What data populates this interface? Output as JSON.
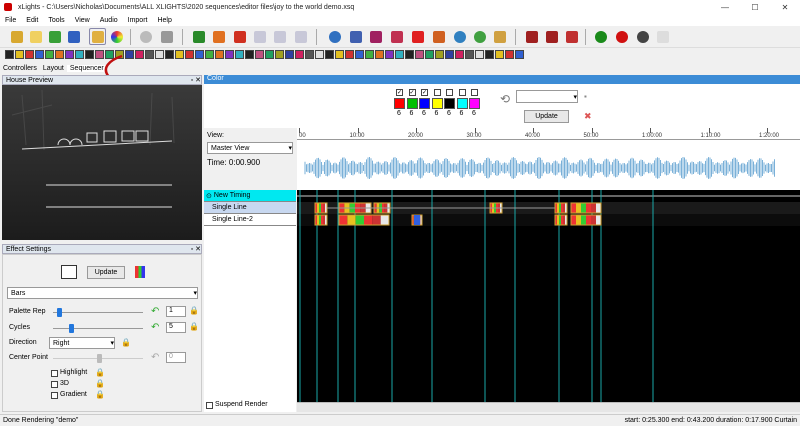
{
  "window": {
    "title": "xLights - C:\\Users\\Nicholas\\Documents\\ALL XLIGHTS\\2020 sequences\\editor files\\joy to the world demo.xsq",
    "minimize": "—",
    "maximize": "☐",
    "close": "✕"
  },
  "menu": [
    "File",
    "Edit",
    "Tools",
    "View",
    "Audio",
    "Import",
    "Help"
  ],
  "toolbar": {
    "icons": [
      "open-folder-icon",
      "new-file-icon",
      "open-file-icon",
      "save-icon",
      "save-as-icon",
      "render-icon",
      "palette-icon",
      "clock-icon",
      "battery-icon",
      "play-icon",
      "pause-icon",
      "stop-icon",
      "rewind-icon",
      "fast-forward-icon",
      "replay-icon",
      "gear-icon",
      "models-icon",
      "effects-icon",
      "layers-icon",
      "star-icon",
      "home-icon",
      "sparkle-icon",
      "brush-icon",
      "zoom-in-icon",
      "zoom-out-icon",
      "bookmark-icon",
      "help-icon",
      "record-icon",
      "light-bulb-icon",
      "bell-icon"
    ],
    "colors": {
      "play": "#2a8a2a",
      "pause": "#e07020",
      "stop": "#d03020",
      "zoom": "#a02020",
      "help": "#1a8a1a",
      "record": "#d01010"
    }
  },
  "tabs": [
    "Controllers",
    "Layout",
    "Sequencer"
  ],
  "house_preview": {
    "title": "House Preview"
  },
  "effect_settings": {
    "title": "Effect Settings",
    "update": "Update",
    "effect": "Bars",
    "palette_rep": {
      "label": "Palette Rep",
      "value": "1"
    },
    "cycles": {
      "label": "Cycles",
      "value": "5"
    },
    "direction": {
      "label": "Direction",
      "value": "Right"
    },
    "center_point": {
      "label": "Center Point",
      "value": "0"
    },
    "highlight": "Highlight",
    "three_d": "3D",
    "gradient": "Gradient"
  },
  "color_panel": {
    "title": "Color",
    "swatches": [
      "#ff0000",
      "#00c000",
      "#0000ff",
      "#ffff00",
      "#000000",
      "#00ffff",
      "#ff00ff"
    ],
    "checked": [
      true,
      true,
      true,
      false,
      false,
      false,
      false
    ],
    "swatch_label": "6",
    "update": "Update"
  },
  "sequencer": {
    "view_label": "View:",
    "view": "Master View",
    "time": "Time: 0:00.900",
    "ticks": [
      "00",
      "10:00",
      "20:00",
      "30:00",
      "40:00",
      "50:00",
      "1:00:00",
      "1:10:00",
      "1:20:00"
    ],
    "rows": [
      "New Timing",
      "Single Line",
      "Single Line-2"
    ],
    "suspend_render": "Suspend Render"
  },
  "status": {
    "left": "Done Rendering \"demo\"",
    "right": "start: 0:25.300  end: 0:43.200  duration: 0:17.900  Curtain"
  }
}
